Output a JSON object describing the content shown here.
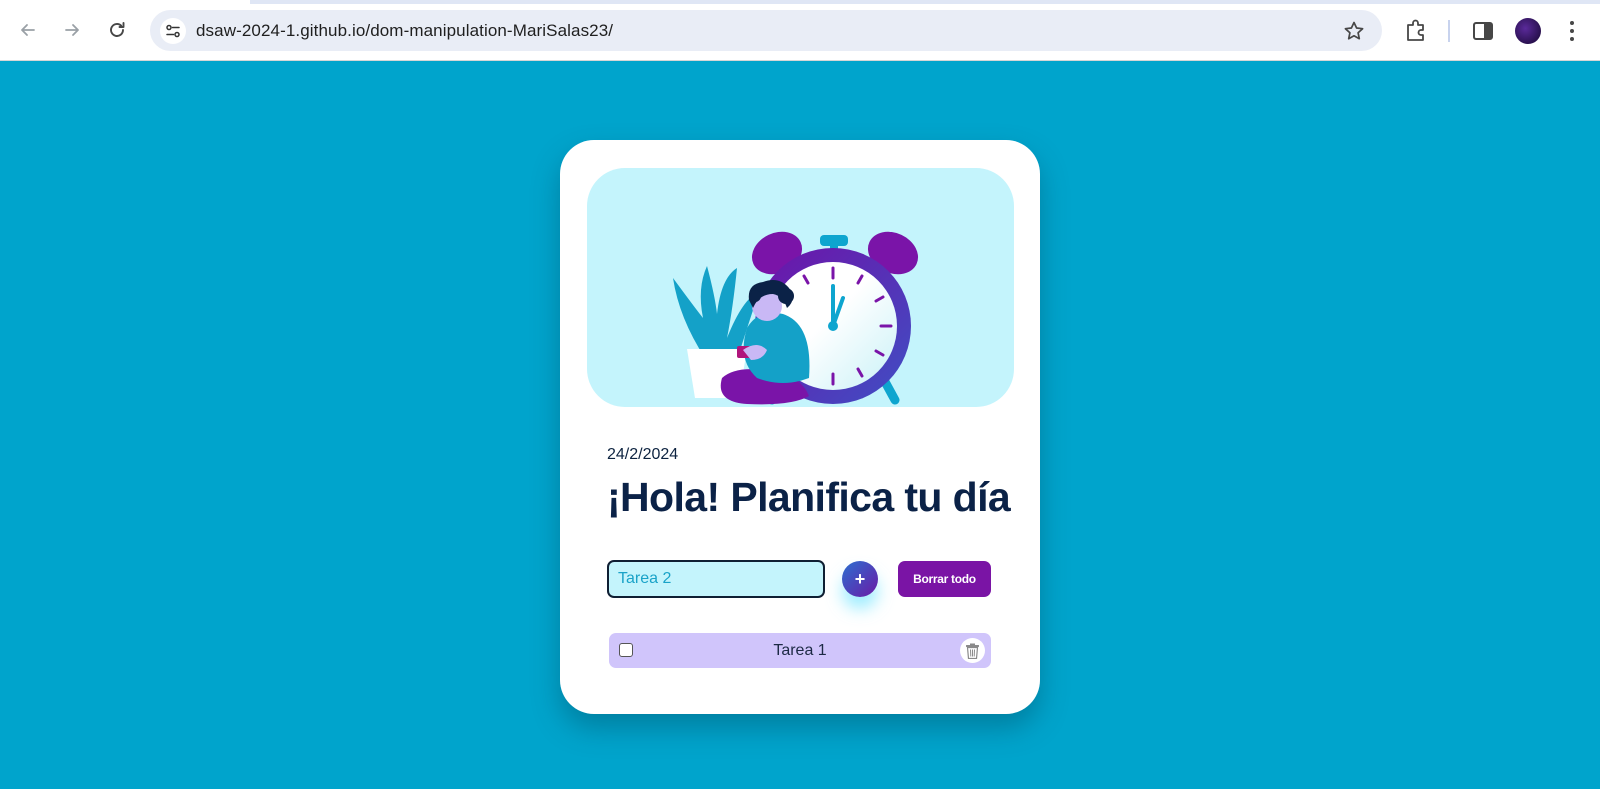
{
  "browser": {
    "url": "dsaw-2024-1.github.io/dom-manipulation-MariSalas23/",
    "icons": [
      "back-arrow-icon",
      "forward-arrow-icon",
      "reload-icon",
      "site-settings-icon",
      "bookmark-star-icon",
      "extensions-puzzle-icon",
      "side-panel-icon",
      "profile-avatar",
      "more-menu-icon"
    ]
  },
  "app": {
    "date": "24/2/2024",
    "greeting": "¡Hola! Planifica tu día",
    "input": {
      "value": "Tarea 2",
      "placeholder": ""
    },
    "add_label": "+",
    "clear_label": "Borrar todo",
    "tasks": [
      {
        "label": "Tarea 1",
        "checked": false
      }
    ]
  },
  "colors": {
    "page_background": "#00a4cc",
    "card_background": "#ffffff",
    "hero_background": "#c4f4fc",
    "title": "#0b2247",
    "clear_button": "#7a14a5",
    "task_row": "#d0c5fb",
    "input_background": "#c4f4fc"
  }
}
